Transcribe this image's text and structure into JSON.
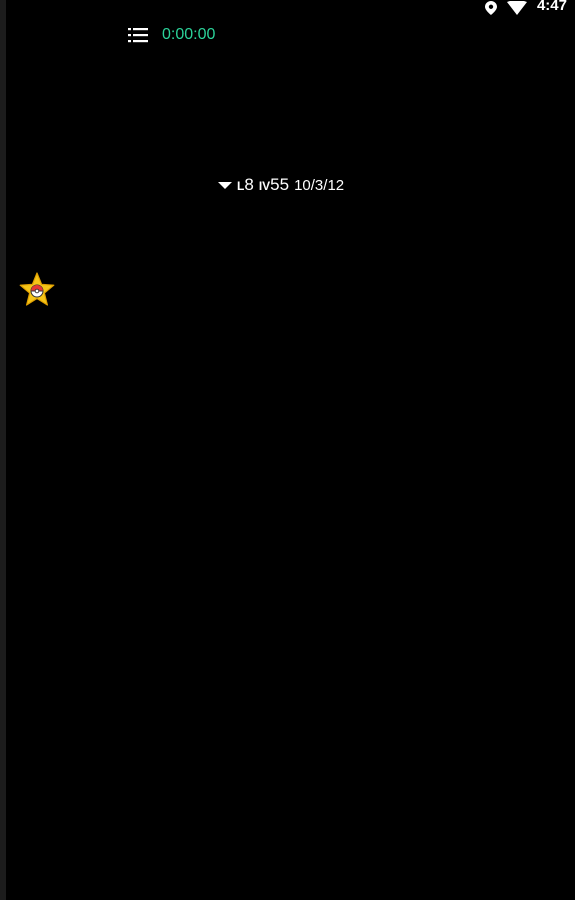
{
  "status_bar": {
    "time": "4:47",
    "icons": [
      "location-pin-icon",
      "wifi-icon"
    ]
  },
  "toolbar": {
    "menu_icon": "list-icon",
    "timer": "0:00:00",
    "timer_color": "#2bd39a"
  },
  "info": {
    "dropdown_icon": "dropdown-triangle-icon",
    "level_prefix": "L",
    "level_value": "8",
    "iv_prefix": "IV",
    "iv_value": "55",
    "stats": "10/3/12"
  },
  "floating_button": {
    "icon": "star-pokeball-icon",
    "star_color": "#f5c518"
  }
}
